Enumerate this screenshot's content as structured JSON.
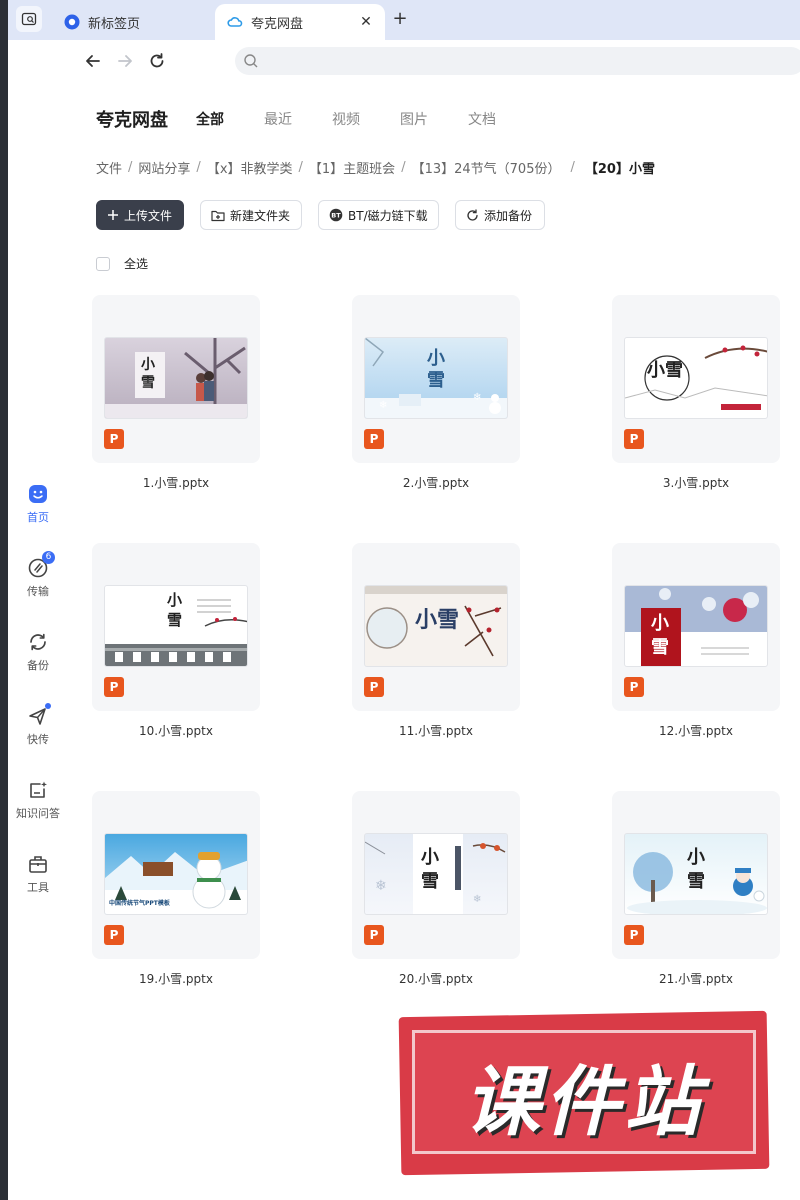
{
  "browser": {
    "tabs": [
      {
        "label": "新标签页",
        "icon": "browser-logo-icon"
      },
      {
        "label": "夸克网盘",
        "icon": "cloud-icon"
      }
    ]
  },
  "rail": {
    "items": [
      {
        "label": "首页",
        "icon": "home-icon",
        "active": true
      },
      {
        "label": "传输",
        "icon": "transfer-icon",
        "badge": "6"
      },
      {
        "label": "备份",
        "icon": "backup-icon"
      },
      {
        "label": "快传",
        "icon": "quick-send-icon"
      },
      {
        "label": "知识问答",
        "icon": "knowledge-qa-icon"
      },
      {
        "label": "工具",
        "icon": "toolbox-icon"
      }
    ]
  },
  "header": {
    "brand": "夸克网盘",
    "filters": [
      "全部",
      "最近",
      "视频",
      "图片",
      "文档"
    ]
  },
  "breadcrumb": {
    "items": [
      "文件",
      "网站分享",
      "【x】非教学类",
      "【1】主题班会",
      "【13】24节气（705份）"
    ],
    "current": "【20】小雪"
  },
  "actions": {
    "upload": "上传文件",
    "new_folder": "新建文件夹",
    "bt": "BT/磁力链下载",
    "backup": "添加备份"
  },
  "select_all": "全选",
  "file_type_badge": "P",
  "files": [
    {
      "name": "1.小雪.pptx",
      "thumb_title": "小雪"
    },
    {
      "name": "2.小雪.pptx",
      "thumb_title": "小雪"
    },
    {
      "name": "3.小雪.pptx",
      "thumb_title": "小雪"
    },
    {
      "name": "10.小雪.pptx",
      "thumb_title": "小雪"
    },
    {
      "name": "11.小雪.pptx",
      "thumb_title": "小雪"
    },
    {
      "name": "12.小雪.pptx",
      "thumb_title": "小雪"
    },
    {
      "name": "19.小雪.pptx",
      "thumb_title": "中国传统节气PPT模板"
    },
    {
      "name": "20.小雪.pptx",
      "thumb_title": "小雪"
    },
    {
      "name": "21.小雪.pptx",
      "thumb_title": "小雪"
    }
  ],
  "watermark": "课件站",
  "colors": {
    "accent": "#3b6df5",
    "ppt": "#e8561e",
    "stamp": "#d93b47"
  }
}
